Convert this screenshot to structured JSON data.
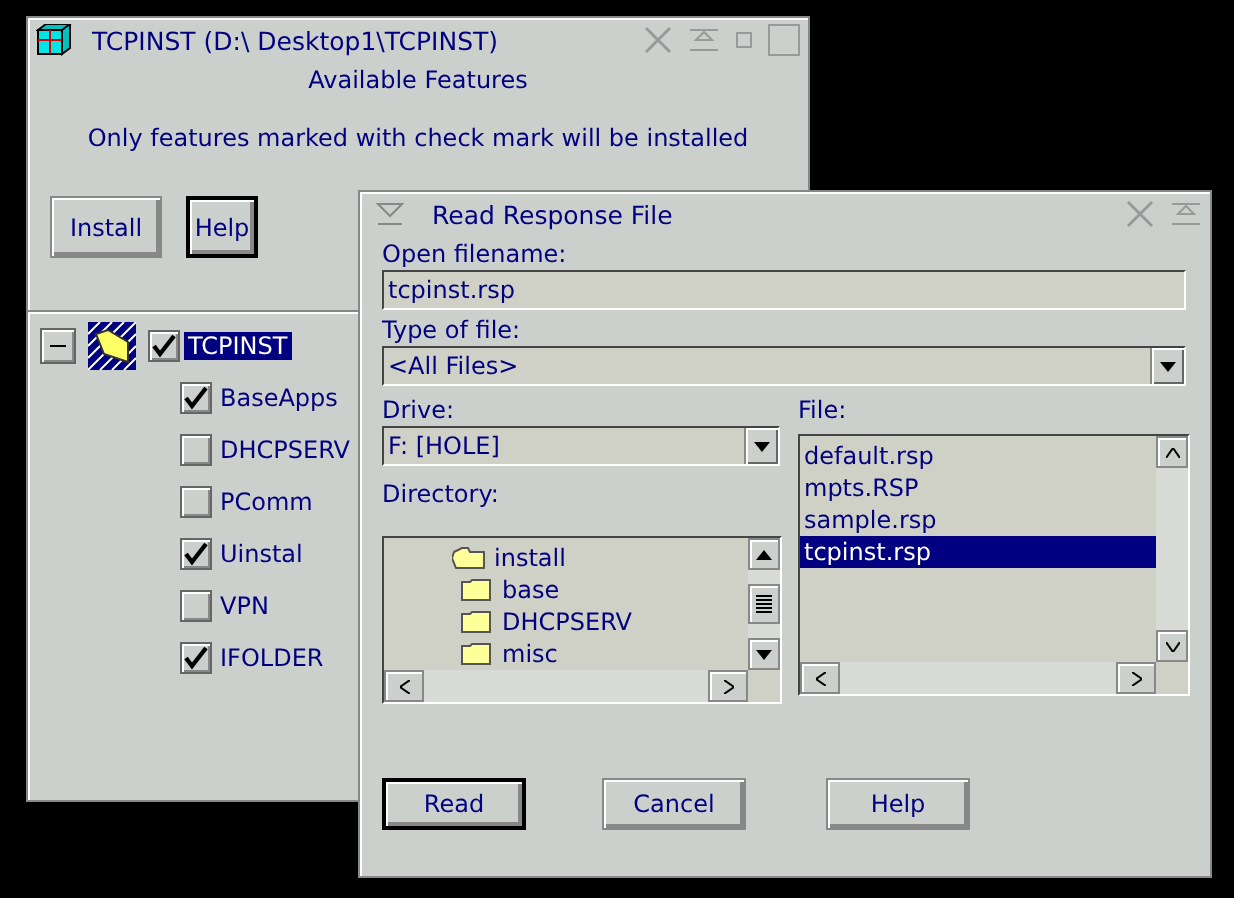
{
  "main_window": {
    "title": "TCPINST (D:\\ Desktop1\\TCPINST)",
    "heading": "Available Features",
    "note": "Only features marked with check mark will be installed",
    "buttons": [
      {
        "label": "Install",
        "default": false
      },
      {
        "label": "Help",
        "default": true
      }
    ],
    "features": [
      {
        "label": "TCPINST",
        "checked": true,
        "selected": true,
        "expanded": true,
        "children": [
          {
            "label": "BaseApps",
            "checked": true,
            "selected": false
          },
          {
            "label": "DHCPSERV",
            "checked": false,
            "selected": false
          },
          {
            "label": "PComm",
            "checked": false,
            "selected": false
          },
          {
            "label": "Uinstal",
            "checked": true,
            "selected": false
          },
          {
            "label": "VPN",
            "checked": false,
            "selected": false
          },
          {
            "label": "IFOLDER",
            "checked": true,
            "selected": false
          }
        ]
      }
    ]
  },
  "dialog": {
    "title": "Read Response File",
    "filename_label": "Open filename:",
    "filename": "tcpinst.rsp",
    "type_label": "Type of file:",
    "type": "<All Files>",
    "drive_label": "Drive:",
    "drive": "F:  [HOLE]",
    "file_label": "File:",
    "directory_label": "Directory:",
    "directories": [
      {
        "name": "install",
        "expanded": true,
        "children": [
          {
            "name": "base",
            "expanded": false
          },
          {
            "name": "DHCPSERV",
            "expanded": false
          },
          {
            "name": "misc",
            "expanded": false
          }
        ]
      }
    ],
    "files": [
      {
        "name": "default.rsp",
        "selected": false
      },
      {
        "name": "mpts.RSP",
        "selected": false
      },
      {
        "name": "sample.rsp",
        "selected": false
      },
      {
        "name": "tcpinst.rsp",
        "selected": true
      }
    ],
    "buttons": [
      {
        "label": "Read",
        "default": true
      },
      {
        "label": "Cancel",
        "default": false
      },
      {
        "label": "Help",
        "default": false
      }
    ]
  }
}
